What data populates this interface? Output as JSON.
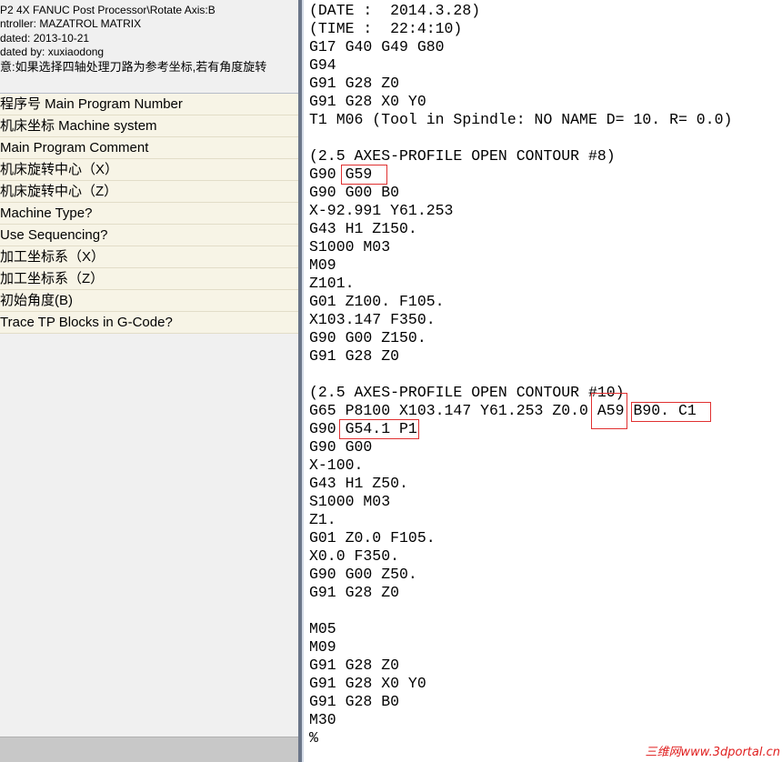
{
  "header": {
    "lines": [
      "P2 4X FANUC Post Processor\\Rotate Axis:B",
      "ntroller: MAZATROL MATRIX",
      "dated: 2013-10-21",
      "dated by: xuxiaodong",
      "意:如果选择四轴处理刀路为参考坐标,若有角度旋转"
    ]
  },
  "properties": [
    {
      "label": "程序号 Main Program Number"
    },
    {
      "label": "机床坐标 Machine system"
    },
    {
      "label": "Main Program Comment"
    },
    {
      "label": "机床旋转中心（X）"
    },
    {
      "label": "机床旋转中心（Z）"
    },
    {
      "label": "Machine Type?"
    },
    {
      "label": "Use Sequencing?"
    },
    {
      "label": "加工坐标系（X）"
    },
    {
      "label": "加工坐标系（Z）"
    },
    {
      "label": "初始角度(B)"
    },
    {
      "label": "Trace TP Blocks in G-Code?"
    }
  ],
  "code_lines": [
    "(DATE :  2014.3.28)",
    "(TIME :  22:4:10)",
    "G17 G40 G49 G80",
    "G94",
    "G91 G28 Z0",
    "G91 G28 X0 Y0",
    "T1 M06 (Tool in Spindle: NO NAME D= 10. R= 0.0)",
    "",
    "(2.5 AXES-PROFILE OPEN CONTOUR #8)",
    "G90 G59",
    "G90 G00 B0",
    "X-92.991 Y61.253",
    "G43 H1 Z150.",
    "S1000 M03",
    "M09",
    "Z101.",
    "G01 Z100. F105.",
    "X103.147 F350.",
    "G90 G00 Z150.",
    "G91 G28 Z0",
    "",
    "(2.5 AXES-PROFILE OPEN CONTOUR #10)",
    "G65 P8100 X103.147 Y61.253 Z0.0 A59 B90. C1",
    "G90 G54.1 P1",
    "G90 G00",
    "X-100.",
    "G43 H1 Z50.",
    "S1000 M03",
    "Z1.",
    "G01 Z0.0 F105.",
    "X0.0 F350.",
    "G90 G00 Z50.",
    "G91 G28 Z0",
    "",
    "M05",
    "M09",
    "G91 G28 Z0",
    "G91 G28 X0 Y0",
    "G91 G28 B0",
    "M30",
    "%"
  ],
  "watermark": "三维网www.3dportal.cn",
  "colors": {
    "highlight": "#e03030",
    "property_bg": "#f7f4e6",
    "watermark": "#e02020"
  }
}
